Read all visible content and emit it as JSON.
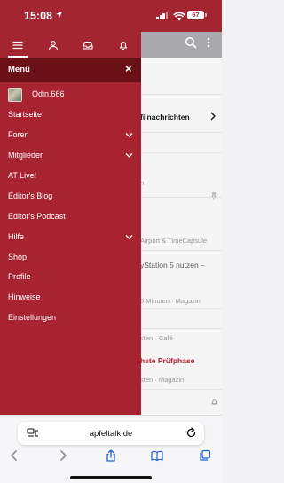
{
  "status": {
    "time": "15:08",
    "battery": "67"
  },
  "menu": {
    "title": "Menü",
    "close_glyph": "×",
    "user": {
      "name": "Odin.666"
    },
    "items": [
      {
        "label": "Startseite",
        "has_submenu": false
      },
      {
        "label": "Foren",
        "has_submenu": true
      },
      {
        "label": "Mitglieder",
        "has_submenu": true
      },
      {
        "label": "AT Live!",
        "has_submenu": false
      },
      {
        "label": "Editor's Blog",
        "has_submenu": false
      },
      {
        "label": "Editor's Podcast",
        "has_submenu": false
      },
      {
        "label": "Hilfe",
        "has_submenu": true
      },
      {
        "label": "Shop",
        "has_submenu": false
      },
      {
        "label": "Profile",
        "has_submenu": false
      },
      {
        "label": "Hinweise",
        "has_submenu": false
      },
      {
        "label": "Einstellungen",
        "has_submenu": false
      }
    ]
  },
  "background": {
    "items": [
      {
        "text": "filnachrichten"
      },
      {
        "text": "n"
      },
      {
        "text": "Airport & TimeCapsule"
      },
      {
        "text": "yStation 5 nutzen –"
      },
      {
        "text": "5 Minuten · Magazin"
      },
      {
        "text": "sten · Café"
      },
      {
        "text": "hste Prüfphase"
      },
      {
        "text": "sten · Magazin"
      }
    ]
  },
  "browser": {
    "url": "apfeltalk.de"
  },
  "colors": {
    "brand": "#a6232f",
    "menu_header": "#6b1017",
    "accent_red": "#b8202a"
  }
}
